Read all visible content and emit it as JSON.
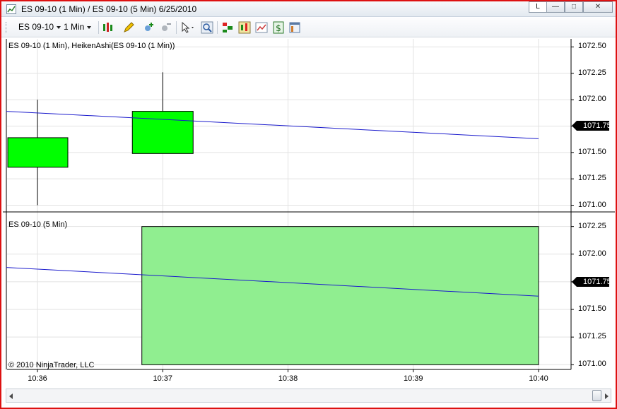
{
  "window": {
    "title": "ES 09-10 (1 Min) / ES 09-10 (5 Min)  6/25/2010",
    "link_button_label": "L",
    "minimize_glyph": "—",
    "maximize_glyph": "□",
    "close_glyph": "✕"
  },
  "toolbar": {
    "instrument": "ES 09-10",
    "interval": "1 Min",
    "icons": [
      "bar-type-icon",
      "drawing-tool-icon",
      "add-indicator-icon",
      "remove-indicator-icon",
      "pointer-icon",
      "zoom-icon",
      "strategies-icon",
      "chart-style-icon",
      "chart-trader-icon",
      "dollar-icon",
      "properties-icon"
    ]
  },
  "colors": {
    "heiken_up": "#00ff00",
    "five_min_bar": "#90ee90",
    "trend_line": "#1a1acc",
    "grid": "#e2e2e2",
    "window_border": "#dd1111"
  },
  "chart_data": [
    {
      "type": "candlestick",
      "panel": "top",
      "title": "ES 09-10 (1 Min), HeikenAshi(ES 09-10 (1 Min))",
      "x_ticks": [
        "10:36",
        "10:37",
        "10:38",
        "10:39",
        "10:40"
      ],
      "y_ticks": [
        "1072.50",
        "1072.25",
        "1072.00",
        "1071.75",
        "1071.50",
        "1071.25",
        "1071.00"
      ],
      "ylim": [
        1070.97,
        1072.55
      ],
      "candles": [
        {
          "time": "10:36",
          "open": 1071.36,
          "close": 1071.64,
          "high": 1072.0,
          "low": 1071.0
        },
        {
          "time": "10:37",
          "open": 1071.49,
          "close": 1071.89,
          "high": 1072.26,
          "low": 1071.49
        }
      ],
      "trend_line": {
        "x": [
          "10:35:45",
          "10:40"
        ],
        "y": [
          1071.89,
          1071.63
        ]
      },
      "last_price": "1071.75"
    },
    {
      "type": "candlestick",
      "panel": "bottom",
      "title": "ES 09-10 (5 Min)",
      "y_ticks": [
        "1072.25",
        "1072.00",
        "1071.75",
        "1071.50",
        "1071.25",
        "1071.00"
      ],
      "ylim": [
        1070.97,
        1072.35
      ],
      "candles": [
        {
          "time_from": "10:36:50",
          "time_to": "10:40",
          "open": 1071.0,
          "close": 1072.25,
          "high": 1072.25,
          "low": 1071.0
        }
      ],
      "trend_line": {
        "x": [
          "10:35:45",
          "10:40"
        ],
        "y": [
          1071.88,
          1071.62
        ]
      },
      "last_price": "1071.75"
    }
  ],
  "footer": {
    "copyright": "© 2010 NinjaTrader, LLC"
  }
}
